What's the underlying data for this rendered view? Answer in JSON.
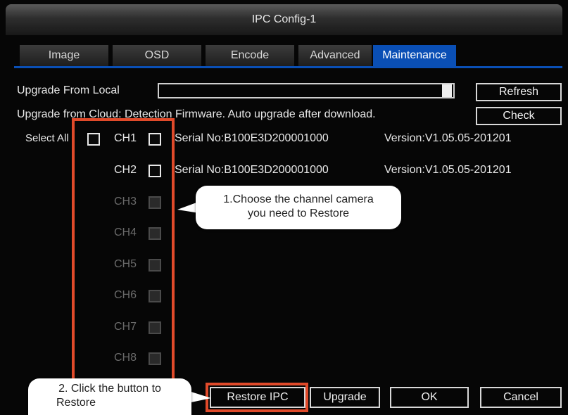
{
  "window": {
    "title": "IPC Config-1"
  },
  "tabs": [
    {
      "label": "Image"
    },
    {
      "label": "OSD"
    },
    {
      "label": "Encode"
    },
    {
      "label": "Advanced"
    },
    {
      "label": "Maintenance",
      "active": true
    }
  ],
  "upgrade_local": {
    "label": "Upgrade From Local",
    "value": "",
    "refresh_label": "Refresh"
  },
  "upgrade_cloud": {
    "label": "Upgrade from Cloud: Detection Firmware. Auto upgrade after download.",
    "check_label": "Check"
  },
  "select_all": {
    "label": "Select All"
  },
  "channels": [
    {
      "label": "CH1",
      "enabled": true,
      "serial": "Serial No:B100E3D200001000",
      "version": "Version:V1.05.05-201201"
    },
    {
      "label": "CH2",
      "enabled": true,
      "serial": "Serial No:B100E3D200001000",
      "version": "Version:V1.05.05-201201"
    },
    {
      "label": "CH3",
      "enabled": false
    },
    {
      "label": "CH4",
      "enabled": false
    },
    {
      "label": "CH5",
      "enabled": false
    },
    {
      "label": "CH6",
      "enabled": false
    },
    {
      "label": "CH7",
      "enabled": false
    },
    {
      "label": "CH8",
      "enabled": false
    }
  ],
  "footer": {
    "restore_label": "Restore IPC",
    "upgrade_label": "Upgrade",
    "ok_label": "OK",
    "cancel_label": "Cancel"
  },
  "callouts": {
    "step1_line1": "1.Choose the channel camera",
    "step1_line2": "you need to Restore",
    "step2_line1": "2. Click the button to",
    "step2_line2": "Restore"
  },
  "colors": {
    "accent": "#0a4fb5",
    "annotation": "#e04a2a",
    "background": "#060606"
  }
}
